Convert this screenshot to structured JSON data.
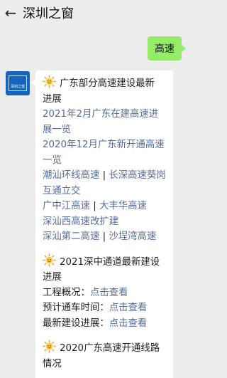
{
  "header": {
    "back_icon": "arrow-left-icon",
    "title": "深圳之窗"
  },
  "messages": {
    "user_message": "高速",
    "account_avatar_text": "深圳之窗"
  },
  "card": {
    "section1": {
      "title_a": "广东部分高速建设最新",
      "title_b": "进展",
      "link1": "2021年2月广东在建高速进展一览",
      "link2": "2020年12月广东新开通高速一览",
      "link3": "潮汕环线高速",
      "sep1": "|",
      "link4": "长深高速葵岗互通立交",
      "link5": "广中江高速",
      "sep2": "|",
      "link6": "大丰华高速",
      "link7": "深汕西高速改扩建",
      "link8": "深汕第二高速",
      "sep3": "|",
      "link9": "沙埕湾高速"
    },
    "section2": {
      "title_a": "2021深中通道最新建设",
      "title_b": "进展",
      "row1_label": "工程概况：",
      "row1_link": "点击查看",
      "row2_label": "预计通车时间：",
      "row2_link": "点击查看",
      "row3_label": "最新建设进展：",
      "row3_link": "点击查看"
    },
    "section3": {
      "title_a": "2020广东高速开通线路",
      "title_b": "情况"
    }
  },
  "colors": {
    "bubble": "#95ec69",
    "link": "#576b95",
    "background": "#ededed"
  }
}
